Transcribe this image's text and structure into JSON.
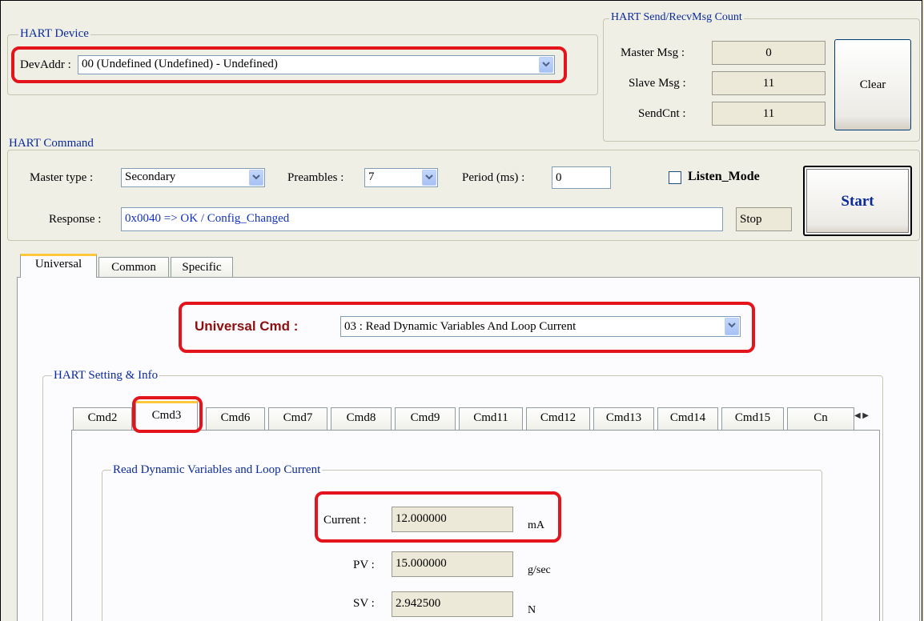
{
  "hart_device": {
    "group_title": "HART Device",
    "devaddr_label": "DevAddr :",
    "devaddr_value": "00  (Undefined (Undefined) - Undefined)"
  },
  "msg_count": {
    "group_title": "HART Send/RecvMsg Count",
    "master_label": "Master Msg :",
    "master_value": "0",
    "slave_label": "Slave Msg :",
    "slave_value": "11",
    "send_label": "SendCnt :",
    "send_value": "11",
    "clear_label": "Clear"
  },
  "hart_command": {
    "group_title": "HART Command",
    "master_type_label": "Master type :",
    "master_type_value": "Secondary",
    "preambles_label": "Preambles :",
    "preambles_value": "7",
    "period_label": "Period (ms) :",
    "period_value": "0",
    "listen_label": "Listen_Mode",
    "listen_checked": false,
    "start_label": "Start",
    "response_label": "Response :",
    "response_value": "0x0040 => OK / Config_Changed",
    "stop_label": "Stop"
  },
  "tabs": [
    {
      "label": "Universal",
      "selected": true
    },
    {
      "label": "Common",
      "selected": false
    },
    {
      "label": "Specific",
      "selected": false
    }
  ],
  "universal": {
    "cmd_label": "Universal Cmd :",
    "cmd_value": "03 : Read Dynamic Variables And Loop Current"
  },
  "setting": {
    "group_title": "HART Setting & Info",
    "cmd_tabs": [
      "Cmd2",
      "Cmd3",
      "Cmd6",
      "Cmd7",
      "Cmd8",
      "Cmd9",
      "Cmd11",
      "Cmd12",
      "Cmd13",
      "Cmd14",
      "Cmd15",
      "Cn"
    ],
    "selected_tab": "Cmd3"
  },
  "dynamic": {
    "group_title": "Read Dynamic Variables and Loop Current",
    "current_label": "Current :",
    "current_value": "12.000000",
    "current_unit": "mA",
    "pv_label": "PV :",
    "pv_value": "15.000000",
    "pv_unit": "g/sec",
    "sv_label": "SV :",
    "sv_value": "2.942500",
    "sv_unit": "N"
  },
  "colors": {
    "highlight": "#e4141c",
    "group_title": "#0a2a9a",
    "response_text": "#1030c0",
    "universal_label": "#8b1010",
    "tab_selected_accent": "#ffc83c"
  }
}
